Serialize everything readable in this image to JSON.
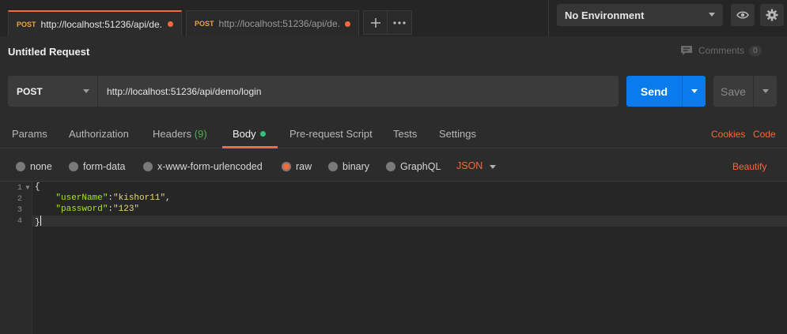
{
  "tabs": [
    {
      "method": "POST",
      "url": "http://localhost:51236/api/de..."
    },
    {
      "method": "POST",
      "url": "http://localhost:51236/api/de..."
    }
  ],
  "env": {
    "selected": "No Environment"
  },
  "request": {
    "title": "Untitled Request",
    "comments_label": "Comments",
    "comments_count": "0"
  },
  "urlbar": {
    "method": "POST",
    "url": "http://localhost:51236/api/demo/login"
  },
  "buttons": {
    "send": "Send",
    "save": "Save"
  },
  "reqtabs": {
    "params": "Params",
    "authorization": "Authorization",
    "headers": "Headers",
    "headers_count": "(9)",
    "body": "Body",
    "prerequest": "Pre-request Script",
    "tests": "Tests",
    "settings": "Settings",
    "cookies": "Cookies",
    "code": "Code"
  },
  "body_options": {
    "none": "none",
    "form_data": "form-data",
    "urlencoded": "x-www-form-urlencoded",
    "raw": "raw",
    "binary": "binary",
    "graphql": "GraphQL",
    "format": "JSON",
    "beautify": "Beautify",
    "selected": "raw"
  },
  "editor": {
    "line_numbers": [
      "1",
      "2",
      "3",
      "4"
    ],
    "open_brace": "{",
    "close_brace": "}",
    "line2_key": "\"userName\"",
    "line2_sep": ":",
    "line2_val": "\"kishor11\"",
    "line2_end": ",",
    "line3_key": "\"password\"",
    "line3_sep": ":",
    "line3_val": "\"123\""
  }
}
